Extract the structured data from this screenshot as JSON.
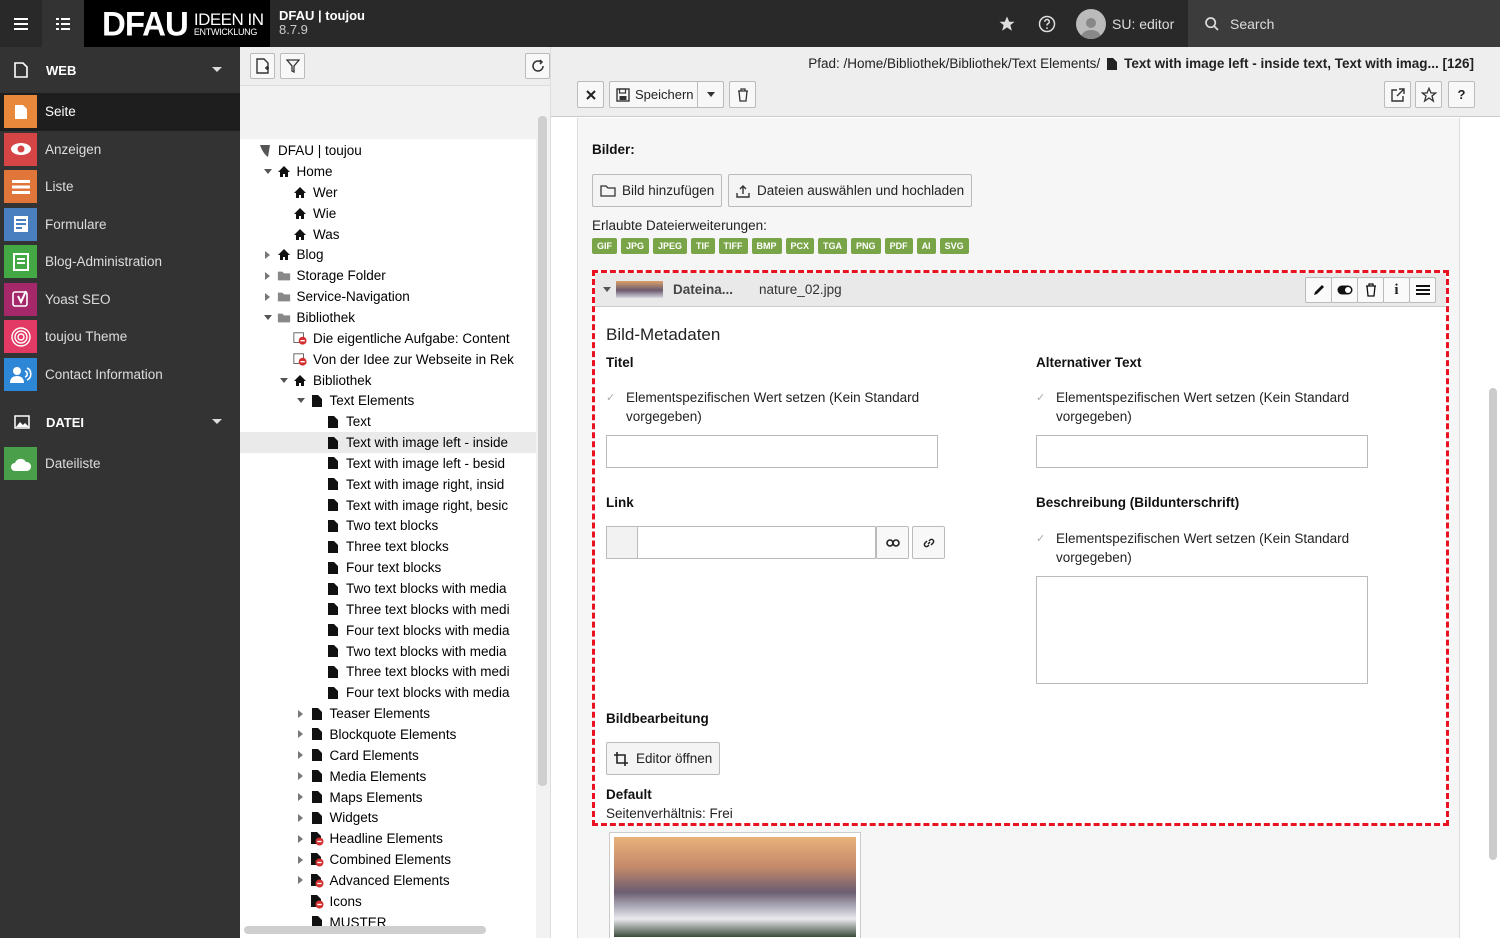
{
  "topbar": {
    "site_name": "DFAU | toujou",
    "version": "8.7.9",
    "logo_text": "DFAU",
    "logo_sub1": "IDEEN IN",
    "logo_sub2": "ENTWICKLUNG",
    "user": "SU: editor",
    "search": "Search"
  },
  "modules": {
    "groups": [
      {
        "label": "WEB"
      },
      {
        "label": "DATEI"
      }
    ],
    "web_items": [
      {
        "label": "Seite",
        "color": "#e8883a"
      },
      {
        "label": "Anzeigen",
        "color": "#d64545"
      },
      {
        "label": "Liste",
        "color": "#e0763a"
      },
      {
        "label": "Formulare",
        "color": "#4a7fbf"
      },
      {
        "label": "Blog-Administration",
        "color": "#44a845"
      },
      {
        "label": "Yoast SEO",
        "color": "#a4286a"
      },
      {
        "label": "toujou Theme",
        "color": "#e23a64"
      },
      {
        "label": "Contact Information",
        "color": "#2e86d6"
      }
    ],
    "file_items": [
      {
        "label": "Dateiliste",
        "color": "#4aa04a"
      }
    ]
  },
  "tree": {
    "root": "DFAU | toujou",
    "nodes": [
      {
        "label": "Home"
      },
      {
        "label": "Wer"
      },
      {
        "label": "Wie"
      },
      {
        "label": "Was"
      },
      {
        "label": "Blog"
      },
      {
        "label": "Storage Folder"
      },
      {
        "label": "Service-Navigation"
      },
      {
        "label": "Bibliothek"
      },
      {
        "label": "Die eigentliche Aufgabe: Content"
      },
      {
        "label": "Von der Idee zur Webseite in Rek"
      },
      {
        "label": "Bibliothek"
      },
      {
        "label": "Text Elements"
      },
      {
        "label": "Text"
      },
      {
        "label": "Text with image left - inside"
      },
      {
        "label": "Text with image left - besid"
      },
      {
        "label": "Text with image right, insid"
      },
      {
        "label": "Text with image right, besic"
      },
      {
        "label": "Two text blocks"
      },
      {
        "label": "Three text blocks"
      },
      {
        "label": "Four text blocks"
      },
      {
        "label": "Two text blocks with media"
      },
      {
        "label": "Three text blocks with medi"
      },
      {
        "label": "Four text blocks with media"
      },
      {
        "label": "Two text blocks with media"
      },
      {
        "label": "Three text blocks with medi"
      },
      {
        "label": "Four text blocks with media"
      },
      {
        "label": "Teaser Elements"
      },
      {
        "label": "Blockquote Elements"
      },
      {
        "label": "Card Elements"
      },
      {
        "label": "Media Elements"
      },
      {
        "label": "Maps Elements"
      },
      {
        "label": "Widgets"
      },
      {
        "label": "Headline Elements"
      },
      {
        "label": "Combined Elements"
      },
      {
        "label": "Advanced Elements"
      },
      {
        "label": "Icons"
      },
      {
        "label": "MUSTER"
      }
    ]
  },
  "docheader": {
    "path_prefix": "Pfad: /Home/Bibliothek/Bibliothek/Text Elements/",
    "path_title": "Text with image left - inside text, Text with imag... [126]",
    "save_label": "Speichern"
  },
  "form": {
    "images_label": "Bilder:",
    "add_image": "Bild hinzufügen",
    "upload": "Dateien auswählen und hochladen",
    "allowed_label": "Erlaubte Dateierweiterungen:",
    "extensions": [
      "GIF",
      "JPG",
      "JPEG",
      "TIF",
      "TIFF",
      "BMP",
      "PCX",
      "TGA",
      "PNG",
      "PDF",
      "AI",
      "SVG"
    ],
    "file_col": "Dateina...",
    "file_name": "nature_02.jpg",
    "metadata_title": "Bild-Metadaten",
    "title_label": "Titel",
    "alt_label": "Alternativer Text",
    "link_label": "Link",
    "desc_label": "Beschreibung (Bildunterschrift)",
    "checkbox_text_1": "Elementspezifischen Wert setzen (Kein Standard",
    "checkbox_text_2": "vorgegeben)",
    "editing_label": "Bildbearbeitung",
    "editor_button": "Editor öffnen",
    "default_label": "Default",
    "aspect_ratio": "Seitenverhältnis: Frei"
  }
}
